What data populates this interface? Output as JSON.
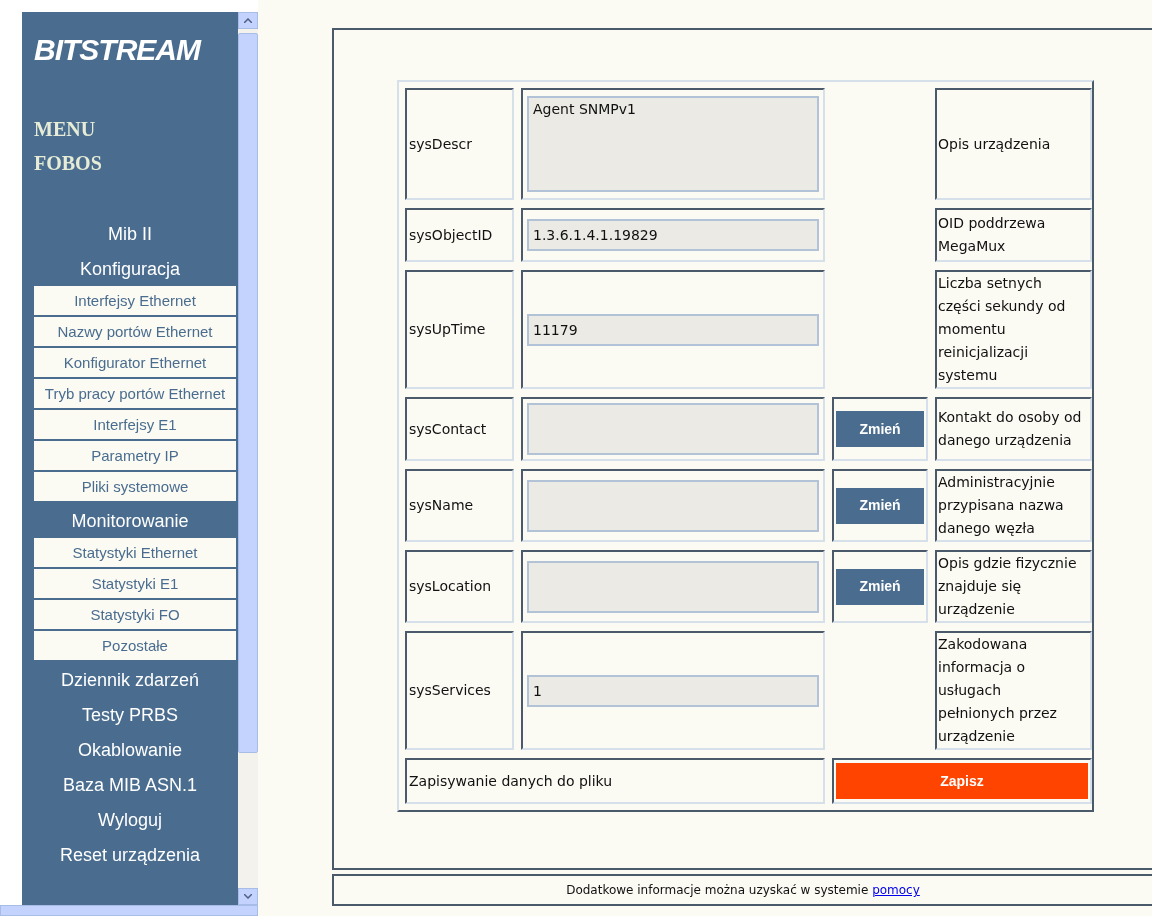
{
  "sidebar": {
    "logo": "BITSTREAM",
    "title_lines": [
      "MENU",
      "FOBOS"
    ],
    "items": [
      {
        "kind": "heading",
        "label": "Mib II"
      },
      {
        "kind": "heading",
        "label": "Konfiguracja"
      },
      {
        "kind": "sub",
        "label": "Interfejsy Ethernet"
      },
      {
        "kind": "sub",
        "label": "Nazwy portów Ethernet"
      },
      {
        "kind": "sub",
        "label": "Konfigurator Ethernet"
      },
      {
        "kind": "sub",
        "label": "Tryb pracy portów Ethernet"
      },
      {
        "kind": "sub",
        "label": "Interfejsy E1"
      },
      {
        "kind": "sub",
        "label": "Parametry IP"
      },
      {
        "kind": "sub",
        "label": "Pliki systemowe"
      },
      {
        "kind": "heading",
        "label": "Monitorowanie"
      },
      {
        "kind": "sub",
        "label": "Statystyki Ethernet"
      },
      {
        "kind": "sub",
        "label": "Statystyki E1"
      },
      {
        "kind": "sub",
        "label": "Statystyki FO"
      },
      {
        "kind": "sub",
        "label": "Pozostałe"
      },
      {
        "kind": "heading",
        "label": "Dziennik zdarzeń"
      },
      {
        "kind": "heading",
        "label": "Testy PRBS"
      },
      {
        "kind": "heading",
        "label": "Okablowanie"
      },
      {
        "kind": "heading",
        "label": "Baza MIB ASN.1"
      },
      {
        "kind": "heading",
        "label": "Wyloguj"
      },
      {
        "kind": "heading",
        "label": "Reset urządzenia"
      }
    ]
  },
  "rows": [
    {
      "label": "sysDescr",
      "kind": "textarea",
      "value": "Agent SNMPv1",
      "description": "Opis urządzenia"
    },
    {
      "label": "sysObjectID",
      "kind": "input",
      "value": "1.3.6.1.4.1.19829",
      "description": "OID poddrzewa MegaMux"
    },
    {
      "label": "sysUpTime",
      "kind": "input",
      "value": "11179",
      "description": "Liczba setnych części sekundy od momentu reinicjalizacji systemu"
    },
    {
      "label": "sysContact",
      "kind": "textarea",
      "button": "Zmień",
      "description": "Kontakt do osoby od danego urządzenia"
    },
    {
      "label": "sysName",
      "kind": "textarea",
      "button": "Zmień",
      "description": "Administracyjnie przypisana nazwa danego węzła"
    },
    {
      "label": "sysLocation",
      "kind": "textarea",
      "button": "Zmień",
      "description": "Opis gdzie fizycznie znajduje się urządzenie"
    },
    {
      "label": "sysServices",
      "kind": "input",
      "value": "1",
      "description": "Zakodowana informacja o usługach pełnionych przez urządzenie"
    }
  ],
  "save": {
    "label": "Zapisywanie danych do pliku",
    "button": "Zapisz"
  },
  "footer": {
    "text": "Dodatkowe informacje można uzyskać w systemie",
    "link": "pomocy"
  }
}
